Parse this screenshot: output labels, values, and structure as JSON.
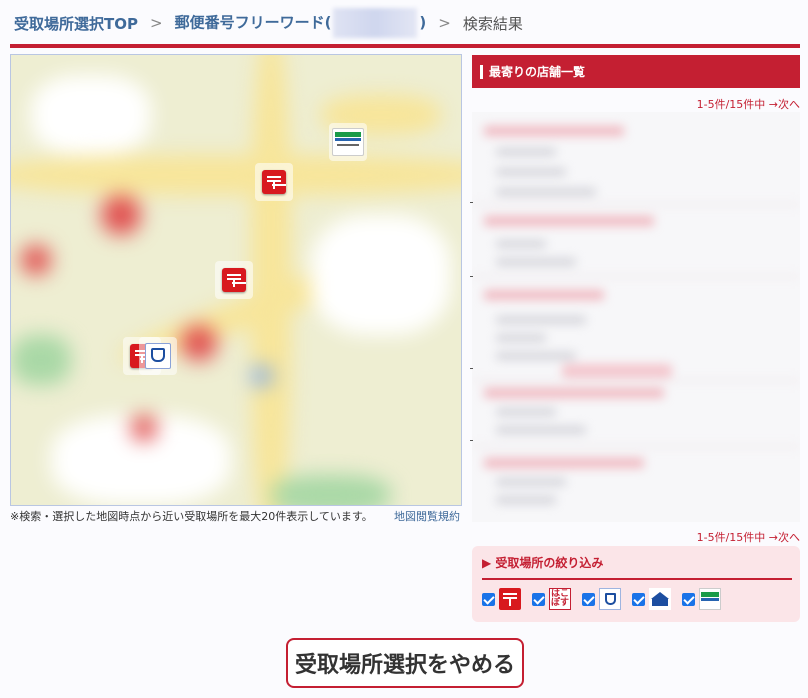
{
  "breadcrumb": {
    "top": "受取場所選択TOP",
    "sep": ">",
    "freeword_label": "郵便番号フリーワード(",
    "freeword_close": ")",
    "current": "検索結果"
  },
  "map": {
    "note": "※検索・選択した地図時点から近い受取場所を最大20件表示しています。",
    "terms": "地図閲覧規約",
    "markers": [
      {
        "brand": "familymart-icon"
      },
      {
        "brand": "post-office-icon"
      },
      {
        "brand": "post-office-icon"
      },
      {
        "brand": "post-office-icon"
      },
      {
        "brand": "lawson-icon"
      }
    ]
  },
  "panel": {
    "title": "最寄りの店舗一覧",
    "pager_range": "1-5件/15件中",
    "pager_next": "→次へ"
  },
  "filter": {
    "title": "▶ 受取場所の絞り込み",
    "hako_text": "はこぽす",
    "brands": [
      "post-office",
      "hakopos",
      "lawson",
      "ministop",
      "familymart"
    ]
  },
  "cancel": {
    "label": "受取場所選択をやめる"
  },
  "colors": {
    "accent": "#c41f32",
    "link": "#3f6a9a"
  }
}
